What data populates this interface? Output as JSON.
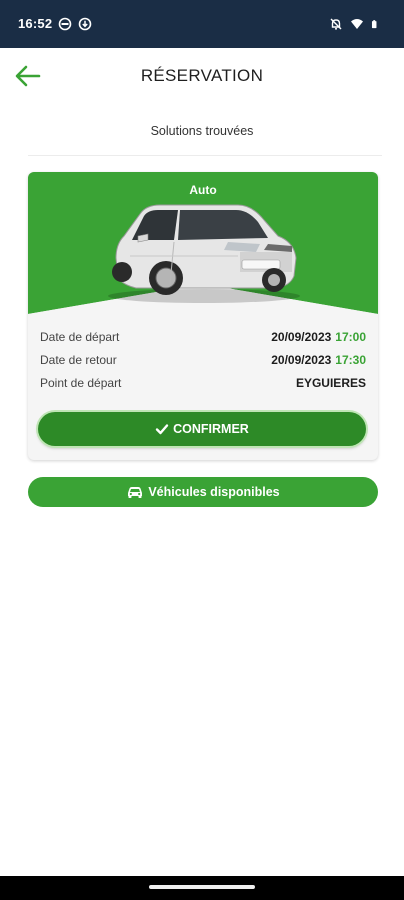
{
  "status_bar": {
    "time": "16:52",
    "icons_left": [
      "vpn-icon",
      "download-icon"
    ],
    "icons_right": [
      "notifications-off-icon",
      "wifi-icon",
      "battery-icon"
    ]
  },
  "header": {
    "title": "RÉSERVATION",
    "back_icon": "arrow-left-icon"
  },
  "subtitle": "Solutions trouvées",
  "card": {
    "type": "Auto",
    "image": "white-hatchback-car",
    "rows": [
      {
        "label": "Date de départ",
        "date": "20/09/2023",
        "time": "17:00"
      },
      {
        "label": "Date de retour",
        "date": "20/09/2023",
        "time": "17:30"
      },
      {
        "label": "Point de départ",
        "value": "EYGUIERES"
      }
    ],
    "confirm_label": "CONFIRMER"
  },
  "vehicles_button": {
    "label": "Véhicules disponibles",
    "icon": "car-icon"
  },
  "colors": {
    "status_bar_bg": "#1a2d45",
    "accent_green": "#3aa335",
    "dark_green": "#2d8a27",
    "card_bg": "#f5f5f5"
  }
}
